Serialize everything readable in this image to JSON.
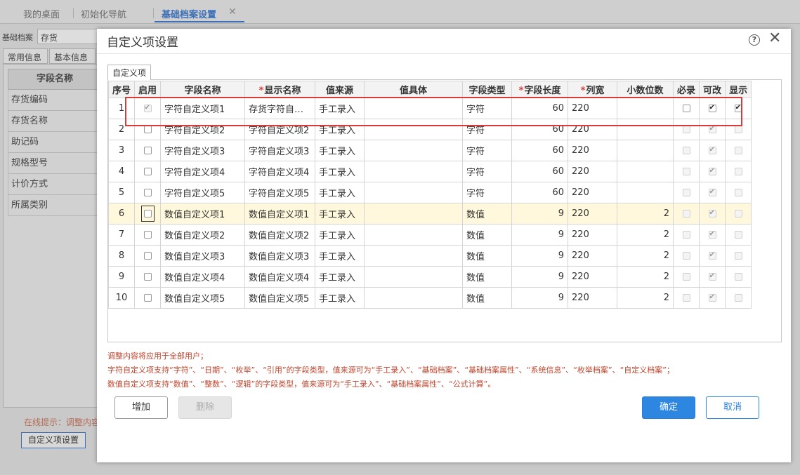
{
  "top_tabs": [
    {
      "label": "我的桌面"
    },
    {
      "label": "初始化导航"
    },
    {
      "label": "基础档案设置",
      "active": true
    }
  ],
  "background": {
    "form_label": "基础档案",
    "form_value": "存货",
    "subtabs": [
      "常用信息",
      "基本信息"
    ],
    "list_header": "字段名称",
    "list_items": [
      "存货编码",
      "存货名称",
      "助记码",
      "规格型号",
      "计价方式",
      "所属类别"
    ],
    "hint": "在线提示：调整内容",
    "button": "自定义项设置"
  },
  "dialog": {
    "title": "自定义项设置",
    "tab": "自定义项",
    "columns": [
      "序号",
      "启用",
      "字段名称",
      "显示名称",
      "值来源",
      "值具体",
      "字段类型",
      "字段长度",
      "列宽",
      "小数位数",
      "必录",
      "可改",
      "显示"
    ],
    "required_columns": [
      "显示名称",
      "字段长度",
      "列宽"
    ],
    "rows": [
      {
        "idx": "1",
        "enabled": true,
        "enabled_disabled": true,
        "field": "字符自定义项1",
        "display": "存货字符自…",
        "source": "手工录入",
        "value": "",
        "type": "字符",
        "length": "60",
        "width": "220",
        "decimals": "",
        "required": false,
        "editable": true,
        "show": true,
        "row_enabled": true
      },
      {
        "idx": "2",
        "enabled": false,
        "field": "字符自定义项2",
        "display": "字符自定义项2",
        "source": "手工录入",
        "value": "",
        "type": "字符",
        "length": "60",
        "width": "220",
        "decimals": "",
        "required": false,
        "editable": true,
        "show": false
      },
      {
        "idx": "3",
        "enabled": false,
        "field": "字符自定义项3",
        "display": "字符自定义项3",
        "source": "手工录入",
        "value": "",
        "type": "字符",
        "length": "60",
        "width": "220",
        "decimals": "",
        "required": false,
        "editable": true,
        "show": false
      },
      {
        "idx": "4",
        "enabled": false,
        "field": "字符自定义项4",
        "display": "字符自定义项4",
        "source": "手工录入",
        "value": "",
        "type": "字符",
        "length": "60",
        "width": "220",
        "decimals": "",
        "required": false,
        "editable": true,
        "show": false
      },
      {
        "idx": "5",
        "enabled": false,
        "field": "字符自定义项5",
        "display": "字符自定义项5",
        "source": "手工录入",
        "value": "",
        "type": "字符",
        "length": "60",
        "width": "220",
        "decimals": "",
        "required": false,
        "editable": true,
        "show": false
      },
      {
        "idx": "6",
        "enabled": false,
        "focused": true,
        "highlight": true,
        "field": "数值自定义项1",
        "display": "数值自定义项1",
        "source": "手工录入",
        "value": "",
        "type": "数值",
        "length": "9",
        "width": "220",
        "decimals": "2",
        "required": false,
        "editable": true,
        "show": false
      },
      {
        "idx": "7",
        "enabled": false,
        "field": "数值自定义项2",
        "display": "数值自定义项2",
        "source": "手工录入",
        "value": "",
        "type": "数值",
        "length": "9",
        "width": "220",
        "decimals": "2",
        "required": false,
        "editable": true,
        "show": false
      },
      {
        "idx": "8",
        "enabled": false,
        "field": "数值自定义项3",
        "display": "数值自定义项3",
        "source": "手工录入",
        "value": "",
        "type": "数值",
        "length": "9",
        "width": "220",
        "decimals": "2",
        "required": false,
        "editable": true,
        "show": false
      },
      {
        "idx": "9",
        "enabled": false,
        "field": "数值自定义项4",
        "display": "数值自定义项4",
        "source": "手工录入",
        "value": "",
        "type": "数值",
        "length": "9",
        "width": "220",
        "decimals": "2",
        "required": false,
        "editable": true,
        "show": false
      },
      {
        "idx": "10",
        "enabled": false,
        "field": "数值自定义项5",
        "display": "数值自定义项5",
        "source": "手工录入",
        "value": "",
        "type": "数值",
        "length": "9",
        "width": "220",
        "decimals": "2",
        "required": false,
        "editable": true,
        "show": false
      }
    ],
    "notes": [
      "调整内容将应用于全部用户；",
      "字符自定义项支持“字符”、“日期”、“枚举”、“引用”的字段类型，值来源可为“手工录入”、“基础档案”、“基础档案属性”、“系统信息”、“枚举档案”、“自定义档案”；",
      "数值自定义项支持“数值”、“整数”、“逻辑”的字段类型，值来源可为“手工录入”、“基础档案属性”、“公式计算”。"
    ],
    "buttons": {
      "add": "增加",
      "delete": "删除",
      "ok": "确定",
      "cancel": "取消"
    }
  },
  "colors": {
    "accent": "#2d86e0",
    "highlight_row": "#fff8dc",
    "annotation_box": "#d93a3a",
    "note_text": "#c0452e"
  }
}
